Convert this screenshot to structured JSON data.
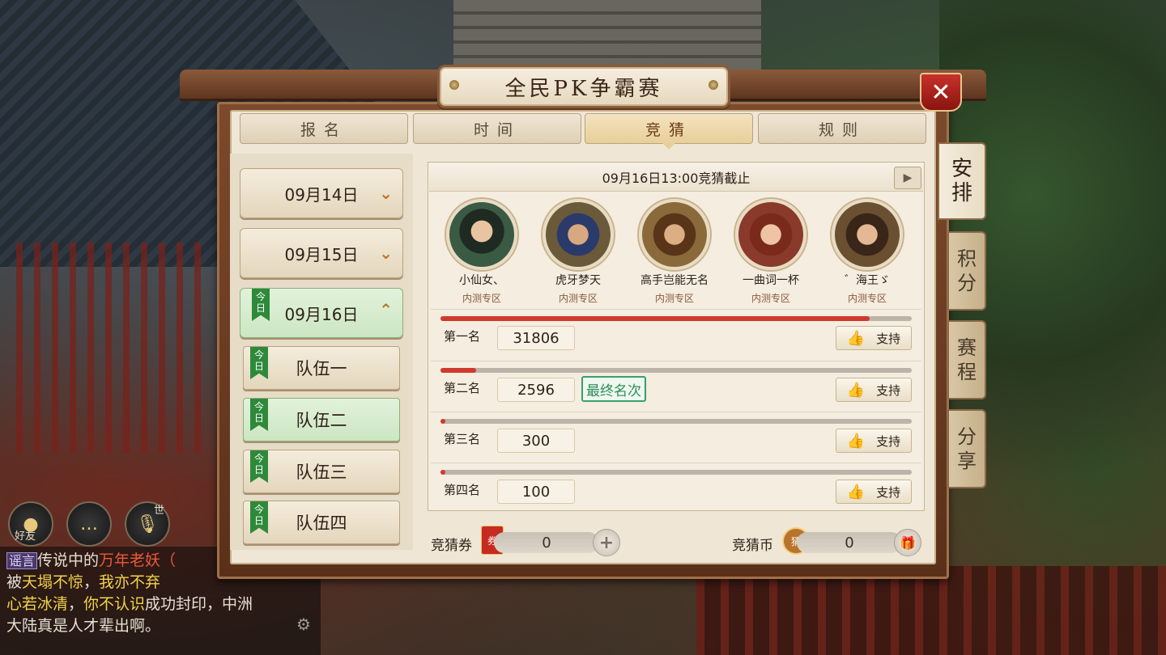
{
  "window": {
    "title": "全民PK争霸赛",
    "close_label": "✕"
  },
  "tabs": [
    {
      "label": "报名",
      "active": false
    },
    {
      "label": "时间",
      "active": false
    },
    {
      "label": "竞猜",
      "active": true
    },
    {
      "label": "规则",
      "active": false
    }
  ],
  "side_tabs": [
    {
      "label": "安排",
      "active": true
    },
    {
      "label": "积分",
      "active": false
    },
    {
      "label": "赛程",
      "active": false
    },
    {
      "label": "分享",
      "active": false
    }
  ],
  "dates": [
    {
      "label": "09月14日",
      "open": false,
      "today": false
    },
    {
      "label": "09月15日",
      "open": false,
      "today": false
    },
    {
      "label": "09月16日",
      "open": true,
      "today": true,
      "today_tag": "今日"
    }
  ],
  "teams": [
    {
      "label": "队伍一",
      "today_tag": "今日",
      "selected": false
    },
    {
      "label": "队伍二",
      "today_tag": "今日",
      "selected": true
    },
    {
      "label": "队伍三",
      "today_tag": "今日",
      "selected": false
    },
    {
      "label": "队伍四",
      "today_tag": "今日",
      "selected": false
    }
  ],
  "guess": {
    "deadline": "09月16日13:00竞猜截止",
    "players": [
      {
        "name": "小仙女、",
        "zone": "内测专区"
      },
      {
        "name": "虎牙梦天",
        "zone": "内测专区"
      },
      {
        "name": "高手岂能无名",
        "zone": "内测专区"
      },
      {
        "name": "一曲词一杯",
        "zone": "内测专区"
      },
      {
        "name": "゛海王ゞ",
        "zone": "内测专区"
      }
    ],
    "ranks": [
      {
        "label": "第一名",
        "votes": "31806",
        "fill": 0.91,
        "final_badge": "",
        "support": "支持"
      },
      {
        "label": "第二名",
        "votes": "2596",
        "fill": 0.075,
        "final_badge": "最终名次",
        "support": "支持"
      },
      {
        "label": "第三名",
        "votes": "300",
        "fill": 0.01,
        "final_badge": "",
        "support": "支持"
      },
      {
        "label": "第四名",
        "votes": "100",
        "fill": 0.01,
        "final_badge": "",
        "support": "支持"
      }
    ]
  },
  "currency": {
    "ticket_label": "竞猜券",
    "ticket_icon_text": "券",
    "ticket_value": "0",
    "coin_label": "竞猜币",
    "coin_icon_text": "猜",
    "coin_value": "0"
  },
  "hud": {
    "friend_label": "好友",
    "world_label": "世"
  },
  "chat": {
    "tag": "谣言",
    "line1_pre": "传说中的",
    "line1_red": "万年老妖",
    "line1_post": "（",
    "line2_pre": "被",
    "line2_yel": "天塌不惊",
    "line2_mid": "，",
    "line2_yel2": "我亦不弃",
    "line3_yel": "心若冰清",
    "line3_mid": "，",
    "line3_yel2": "你不认识",
    "line3_post": "成功封印，中洲",
    "line4": "大陆真是人才辈出啊。"
  },
  "colors": {
    "accent_red": "#d0392e",
    "today_green": "#2e8a3a",
    "badge_green": "#2e8a5a"
  }
}
